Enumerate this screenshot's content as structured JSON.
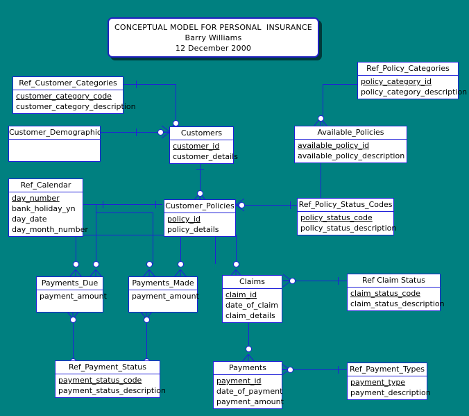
{
  "diagram": {
    "background_color": "#008080",
    "entity_fill": "#ffffff",
    "line_color": "#2020d8",
    "title": {
      "line1": "CONCEPTUAL MODEL FOR PERSONAL  INSURANCE",
      "line2": "Barry Williams",
      "line3": "12 December 2000"
    },
    "entities": [
      {
        "id": "ref_customer_categories",
        "name": "Ref_Customer_Categories",
        "attributes": [
          {
            "text": "customer_category_code",
            "key": true
          },
          {
            "text": "customer_category_description",
            "key": false
          }
        ]
      },
      {
        "id": "customer_demographics",
        "name": "Customer_Demographics",
        "attributes": []
      },
      {
        "id": "customers",
        "name": "Customers",
        "attributes": [
          {
            "text": "customer_id",
            "key": true
          },
          {
            "text": "customer_details",
            "key": false
          }
        ]
      },
      {
        "id": "ref_policy_categories",
        "name": "Ref_Policy_Categories",
        "attributes": [
          {
            "text": "policy_category_id",
            "key": true
          },
          {
            "text": "policy_category_description",
            "key": false
          }
        ]
      },
      {
        "id": "available_policies",
        "name": "Available_Policies",
        "attributes": [
          {
            "text": "available_policy_id",
            "key": true
          },
          {
            "text": "available_policy_description",
            "key": false
          }
        ]
      },
      {
        "id": "ref_calendar",
        "name": "Ref_Calendar",
        "attributes": [
          {
            "text": "day_number",
            "key": true
          },
          {
            "text": "bank_holiday_yn",
            "key": false
          },
          {
            "text": "day_date",
            "key": false
          },
          {
            "text": "day_month_number",
            "key": false
          }
        ]
      },
      {
        "id": "customer_policies",
        "name": "Customer_Policies",
        "attributes": [
          {
            "text": "policy_id",
            "key": true
          },
          {
            "text": "policy_details",
            "key": false
          }
        ]
      },
      {
        "id": "ref_policy_status_codes",
        "name": "Ref_Policy_Status_Codes",
        "attributes": [
          {
            "text": "policy_status_code",
            "key": true
          },
          {
            "text": "policy_status_description",
            "key": false
          }
        ]
      },
      {
        "id": "payments_due",
        "name": "Payments_Due",
        "attributes": [
          {
            "text": "payment_amount",
            "key": false
          }
        ]
      },
      {
        "id": "payments_made",
        "name": "Payments_Made",
        "attributes": [
          {
            "text": "payment_amount",
            "key": false
          }
        ]
      },
      {
        "id": "claims",
        "name": "Claims",
        "attributes": [
          {
            "text": "claim_id",
            "key": true
          },
          {
            "text": "date_of_claim",
            "key": false
          },
          {
            "text": "claim_details",
            "key": false
          }
        ]
      },
      {
        "id": "ref_claim_status",
        "name": "Ref Claim Status",
        "attributes": [
          {
            "text": "claim_status_code",
            "key": true
          },
          {
            "text": "claim_status_description",
            "key": false
          }
        ]
      },
      {
        "id": "ref_payment_status",
        "name": "Ref_Payment_Status",
        "attributes": [
          {
            "text": "payment_status_code",
            "key": true
          },
          {
            "text": "payment_status_description",
            "key": false
          }
        ]
      },
      {
        "id": "payments",
        "name": "Payments",
        "attributes": [
          {
            "text": "payment_id",
            "key": true
          },
          {
            "text": "date_of_payment",
            "key": false
          },
          {
            "text": "payment_amount",
            "key": false
          }
        ]
      },
      {
        "id": "ref_payment_types",
        "name": "Ref_Payment_Types",
        "attributes": [
          {
            "text": "payment_type",
            "key": true
          },
          {
            "text": "payment_description",
            "key": false
          }
        ]
      }
    ],
    "relationships": [
      {
        "from": "ref_customer_categories",
        "to": "customers",
        "from_card": "one",
        "to_card": "zero-or-many"
      },
      {
        "from": "customer_demographics",
        "to": "customers",
        "from_card": "one",
        "to_card": "zero-or-many"
      },
      {
        "from": "customers",
        "to": "customer_policies",
        "from_card": "one",
        "to_card": "zero-or-many"
      },
      {
        "from": "ref_policy_categories",
        "to": "available_policies",
        "from_card": "one",
        "to_card": "zero-or-many"
      },
      {
        "from": "available_policies",
        "to": "customer_policies",
        "from_card": "one",
        "to_card": "zero-or-many"
      },
      {
        "from": "ref_calendar",
        "to": "customer_policies",
        "from_card": "one",
        "to_card": "zero-or-many"
      },
      {
        "from": "ref_calendar",
        "to": "payments_due",
        "from_card": "one",
        "to_card": "zero-or-many"
      },
      {
        "from": "ref_calendar",
        "to": "payments_made",
        "from_card": "one",
        "to_card": "zero-or-many"
      },
      {
        "from": "customer_policies",
        "to": "ref_policy_status_codes",
        "from_card": "zero-or-many",
        "to_card": "one"
      },
      {
        "from": "customer_policies",
        "to": "payments_due",
        "from_card": "one",
        "to_card": "zero-or-many"
      },
      {
        "from": "customer_policies",
        "to": "payments_made",
        "from_card": "one",
        "to_card": "zero-or-many"
      },
      {
        "from": "customer_policies",
        "to": "claims",
        "from_card": "one",
        "to_card": "zero-or-many"
      },
      {
        "from": "claims",
        "to": "ref_claim_status",
        "from_card": "zero-or-many",
        "to_card": "one"
      },
      {
        "from": "claims",
        "to": "payments",
        "from_card": "one",
        "to_card": "zero-or-many"
      },
      {
        "from": "payments_due",
        "to": "ref_payment_status",
        "from_card": "zero-or-many",
        "to_card": "one"
      },
      {
        "from": "payments_made",
        "to": "ref_payment_status",
        "from_card": "zero-or-many",
        "to_card": "one"
      },
      {
        "from": "payments",
        "to": "ref_payment_types",
        "from_card": "zero-or-many",
        "to_card": "one"
      }
    ]
  }
}
